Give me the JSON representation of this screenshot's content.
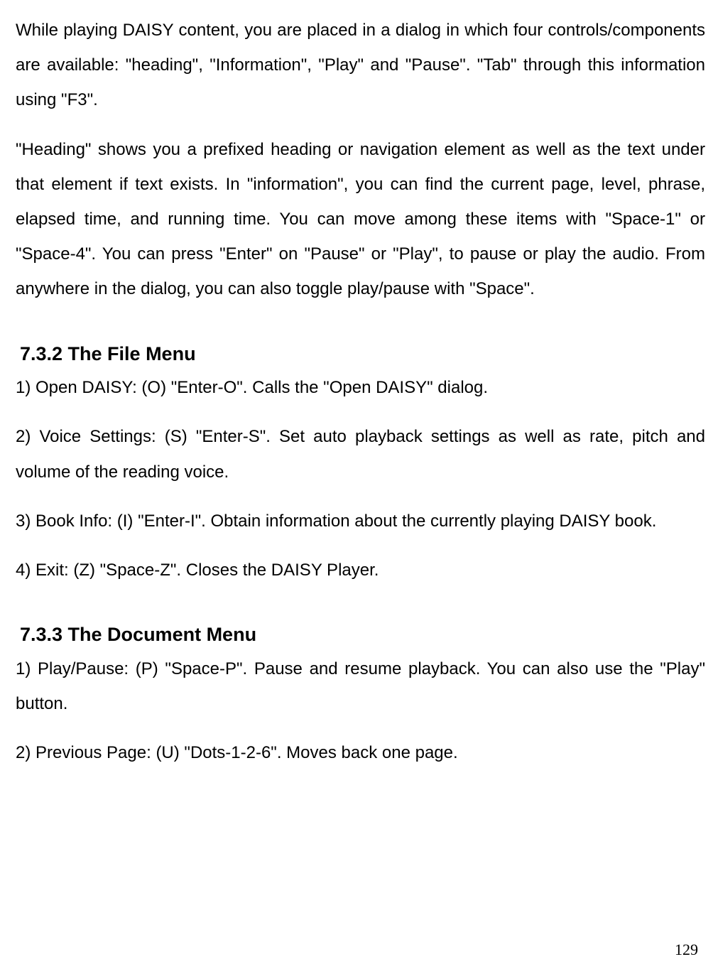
{
  "paragraphs": {
    "p1": "While playing DAISY content, you are placed in a dialog in which four controls/components are available: \"heading\", \"Information\", \"Play\" and \"Pause\". \"Tab\" through this information using \"F3\".",
    "p2": "\"Heading\" shows you a prefixed heading or navigation element as well as the text under that element if text exists. In \"information\", you can find the current page, level, phrase, elapsed time, and running time. You can move among these items with \"Space-1\" or \"Space-4\". You can press \"Enter\" on \"Pause\" or \"Play\", to pause or play the audio. From anywhere in the dialog, you can also toggle play/pause with \"Space\"."
  },
  "section732": {
    "heading": "7.3.2 The File Menu",
    "item1": "1) Open DAISY: (O) \"Enter-O\". Calls the \"Open DAISY\" dialog.",
    "item2": "2) Voice Settings: (S) \"Enter-S\". Set auto playback settings as well as rate, pitch and volume of the reading voice.",
    "item3": "3) Book Info: (I) \"Enter-I\". Obtain information about the currently playing DAISY book.",
    "item4": "4) Exit: (Z) \"Space-Z\". Closes the DAISY Player."
  },
  "section733": {
    "heading": "7.3.3 The Document Menu",
    "item1": "1) Play/Pause: (P) \"Space-P\". Pause and resume playback. You can also use the \"Play\" button.",
    "item2": "2) Previous Page: (U) \"Dots-1-2-6\". Moves back one page."
  },
  "page_number": "129"
}
